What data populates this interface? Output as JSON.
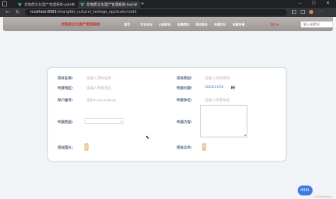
{
  "browser": {
    "tabs": [
      {
        "title": "非物质文化遗产管理系统-admin"
      },
      {
        "title": "非物质文化遗产管理系统-home"
      }
    ],
    "new_tab_symbol": "+",
    "window_controls": {
      "minimize": "—",
      "maximize": "☐",
      "close": "✕"
    },
    "url_host": "localhost:8081",
    "url_path": "/intangible_cultural_heritage_application/edit",
    "nav": {
      "back": "←",
      "refresh": "↻",
      "info": "ⓘ"
    }
  },
  "header": {
    "title": "非物质文化遗产管理系统",
    "menu": [
      "首页",
      "文化论坛",
      "公告资讯",
      "非遗类别",
      "周边商品",
      "非遗文化",
      "非遗申请"
    ],
    "profile_label": "我的",
    "search_placeholder": "输入关键词"
  },
  "form": {
    "project_name_label": "项目名称:",
    "project_name_placeholder": "请输入项目名称",
    "project_category_label": "项目类别:",
    "project_category_placeholder": "请输入项目类别",
    "region_label": "申报地区:",
    "region_placeholder": "请输入申报地区",
    "date_label": "申报日期:",
    "date_value": "2023/11/03",
    "user_id_label": "用户编号:",
    "user_id_value": "请选中 subiuseiking",
    "unit_label": "申报单位:",
    "unit_placeholder": "请输入申报单位",
    "type_label": "申报类型:",
    "content_label": "申报内容:",
    "image_label": "项目图片:",
    "file_label": "项目文件:",
    "upload_symbol": "+"
  },
  "widget": {
    "badge_text": "8434",
    "watermark": "CSDN@ddbian"
  },
  "colors": {
    "title_red": "#c9352a",
    "label": "#5b6f8a",
    "upload": "#f2c8a0",
    "badge": "#3e7be0"
  }
}
